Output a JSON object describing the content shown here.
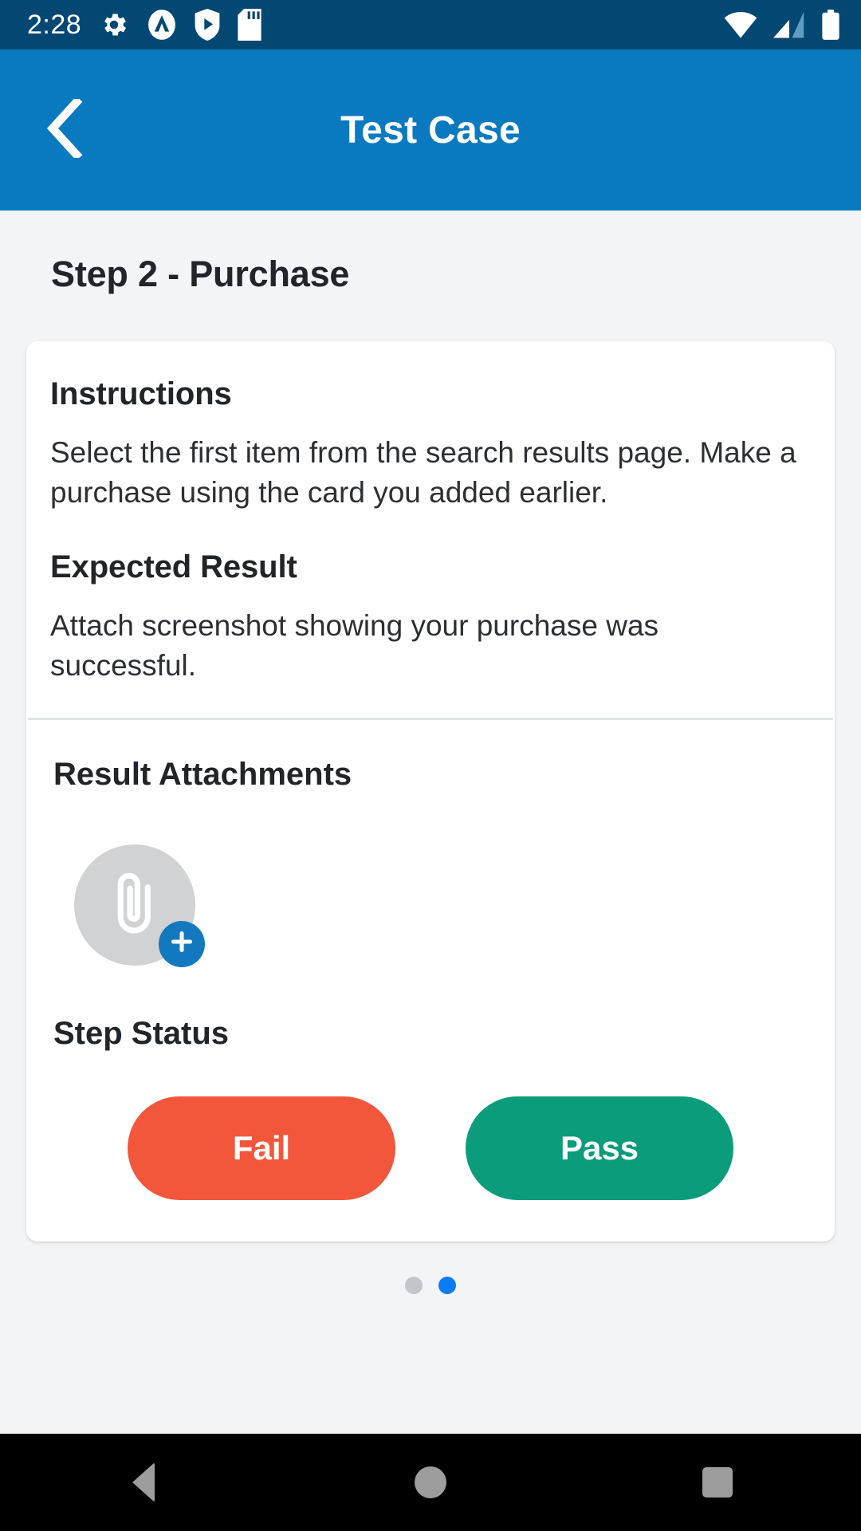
{
  "status_bar": {
    "time": "2:28",
    "left_icons": [
      "gear-icon",
      "circle-a-icon",
      "shield-play-icon",
      "sd-card-icon"
    ],
    "right_icons": [
      "wifi-icon",
      "cell-signal-icon",
      "battery-icon"
    ],
    "background": "#034872"
  },
  "app_bar": {
    "title": "Test Case",
    "back_icon": "chevron-left-icon",
    "background": "#0a7ac0"
  },
  "page": {
    "step_title": "Step 2 - Purchase"
  },
  "card": {
    "instructions": {
      "heading": "Instructions",
      "body": "Select the first item from the search results page. Make a purchase using the card you added earlier."
    },
    "expected_result": {
      "heading": "Expected Result",
      "body": "Attach screenshot showing your purchase was successful."
    },
    "attachments": {
      "heading": "Result Attachments",
      "add_icon": "paperclip-icon",
      "badge_icon": "plus-icon",
      "badge_color": "#1379bf"
    },
    "step_status": {
      "heading": "Step Status",
      "fail_label": "Fail",
      "pass_label": "Pass",
      "fail_color": "#f2573c",
      "pass_color": "#0b9c7b"
    }
  },
  "pager": {
    "dots": [
      {
        "state": "inactive",
        "color": "#c3c6c9"
      },
      {
        "state": "active",
        "color": "#0a7cf5"
      }
    ]
  },
  "nav_bar": {
    "items": [
      "back-triangle-icon",
      "home-circle-icon",
      "recents-square-icon"
    ],
    "background": "#000000"
  }
}
